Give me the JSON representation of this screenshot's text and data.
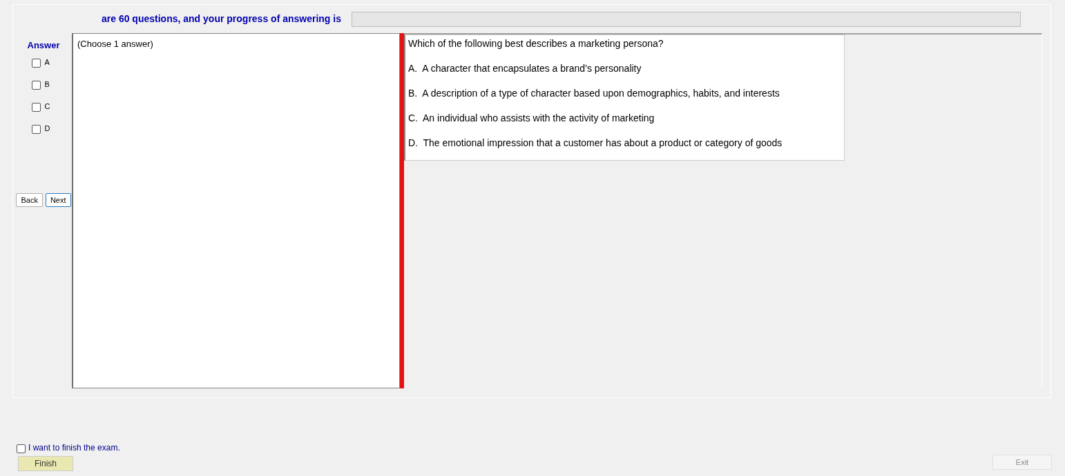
{
  "header": {
    "text": "are 60 questions, and your progress of answering is",
    "progress": {
      "level": 0
    }
  },
  "answer_panel": {
    "title": "Answer",
    "options": [
      {
        "label": "A",
        "checked": false
      },
      {
        "label": "B",
        "checked": false
      },
      {
        "label": "C",
        "checked": false
      },
      {
        "label": "D",
        "checked": false
      }
    ],
    "buttons": [
      "Back",
      "Next"
    ]
  },
  "answer_box": {
    "text": "(Choose 1 answer)"
  },
  "question": {
    "text": "Which of the following best describes a marketing persona?",
    "choices": [
      "A.  A character that encapsulates a brand’s personality",
      "B.  A description of a type of character based upon demographics, habits, and interests",
      "C.  An individual who assists with the activity of marketing",
      "D.  The emotional impression that a customer has about a product or category of goods"
    ]
  },
  "finish": {
    "label": "I want to finish the exam.",
    "checked": false,
    "button": "Finish"
  },
  "exit_button": "Exit"
}
